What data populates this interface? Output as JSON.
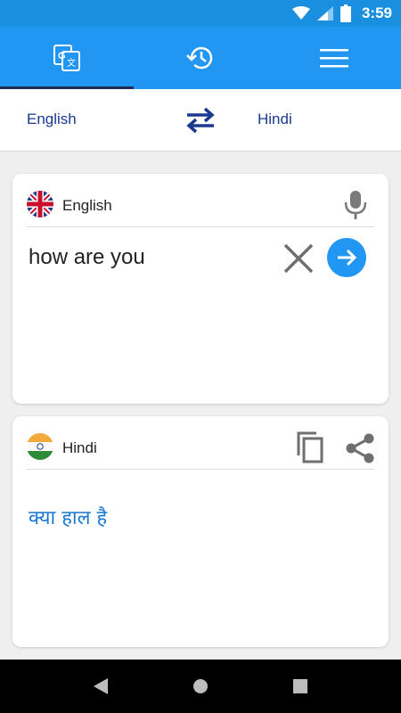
{
  "status_bar": {
    "time": "3:59",
    "icons": [
      "wifi-icon",
      "signal-icon",
      "battery-icon"
    ]
  },
  "tabs": [
    {
      "name": "translate",
      "icon": "translate-icon",
      "active": true
    },
    {
      "name": "history",
      "icon": "history-icon",
      "active": false
    },
    {
      "name": "menu",
      "icon": "menu-icon",
      "active": false
    }
  ],
  "language_bar": {
    "source": "English",
    "target": "Hindi",
    "swap_icon": "swap-icon"
  },
  "input_card": {
    "language": "English",
    "flag": "uk-flag",
    "text": "how are you"
  },
  "output_card": {
    "language": "Hindi",
    "flag": "india-flag",
    "text": "क्या हाल है"
  },
  "nav_bar": {
    "buttons": [
      "back-icon",
      "home-icon",
      "recents-icon"
    ]
  },
  "colors": {
    "primary": "#2196f3",
    "status_bar": "#1a8fe0",
    "language_text": "#1a3a8f",
    "output_text": "#1a78d0",
    "tab_indicator": "#1c2d52"
  }
}
